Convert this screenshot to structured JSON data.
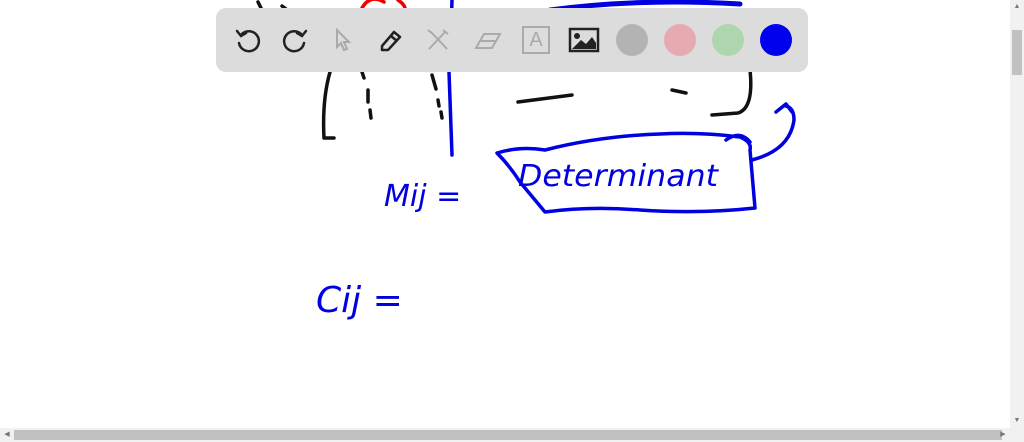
{
  "toolbar": {
    "tools": [
      {
        "name": "undo",
        "icon": "undo-icon",
        "enabled": true
      },
      {
        "name": "redo",
        "icon": "redo-icon",
        "enabled": true
      },
      {
        "name": "select",
        "icon": "pointer-icon",
        "enabled": false
      },
      {
        "name": "pen",
        "icon": "pencil-icon",
        "enabled": true
      },
      {
        "name": "tools",
        "icon": "tools-icon",
        "enabled": false
      },
      {
        "name": "eraser",
        "icon": "eraser-icon",
        "enabled": false
      },
      {
        "name": "text",
        "icon": "text-box-icon",
        "enabled": false
      },
      {
        "name": "image",
        "icon": "image-icon",
        "enabled": true
      }
    ],
    "text_tool_glyph": "A",
    "colors": [
      "#b3b3b3",
      "#e6aab0",
      "#afd6af",
      "#0000ee"
    ],
    "selected_color": "#0000ee"
  },
  "whiteboard": {
    "annotation_minor": "Mij =",
    "annotation_label": "Determinant",
    "annotation_cofactor": "Cij ="
  },
  "scrollbars": {
    "up": "▲",
    "down": "▼",
    "left": "◀",
    "right": "▶"
  }
}
